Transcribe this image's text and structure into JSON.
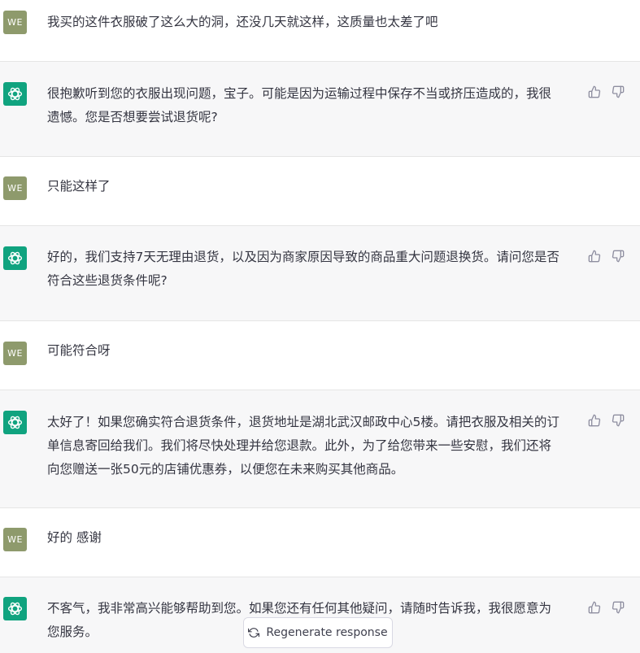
{
  "user_avatar": "WE",
  "messages": [
    {
      "role": "user",
      "text": "我买的这件衣服破了这么大的洞，还没几天就这样，这质量也太差了吧"
    },
    {
      "role": "assistant",
      "text": "很抱歉听到您的衣服出现问题，宝子。可能是因为运输过程中保存不当或挤压造成的，我很\n遗憾。您是否想要尝试退货呢?"
    },
    {
      "role": "user",
      "text": "只能这样了"
    },
    {
      "role": "assistant",
      "text": "好的，我们支持7天无理由退货，以及因为商家原因导致的商品重大问题退换货。请问您是否\n符合这些退货条件呢?"
    },
    {
      "role": "user",
      "text": "可能符合呀"
    },
    {
      "role": "assistant",
      "text": "太好了！如果您确实符合退货条件，退货地址是湖北武汉邮政中心5楼。请把衣服及相关的订\n单信息寄回给我们。我们将尽快处理并给您退款。此外，为了给您带来一些安慰，我们还将\n向您赠送一张50元的店铺优惠券，以便您在未来购买其他商品。"
    },
    {
      "role": "user",
      "text": "好的 感谢"
    },
    {
      "role": "assistant",
      "text": "不客气，我非常高兴能够帮助到您。如果您还有任何其他疑问，请随时告诉我，我很愿意为\n您服务。"
    }
  ],
  "regenerate_label": "Regenerate response",
  "colors": {
    "assistant_bg": "#f7f7f8",
    "bot_avatar": "#10a37f",
    "user_avatar": "#8e9a6c"
  },
  "icons": {
    "bot": "openai-logo-icon",
    "thumbs_up": "thumbs-up-icon",
    "thumbs_down": "thumbs-down-icon",
    "regenerate": "refresh-icon"
  }
}
